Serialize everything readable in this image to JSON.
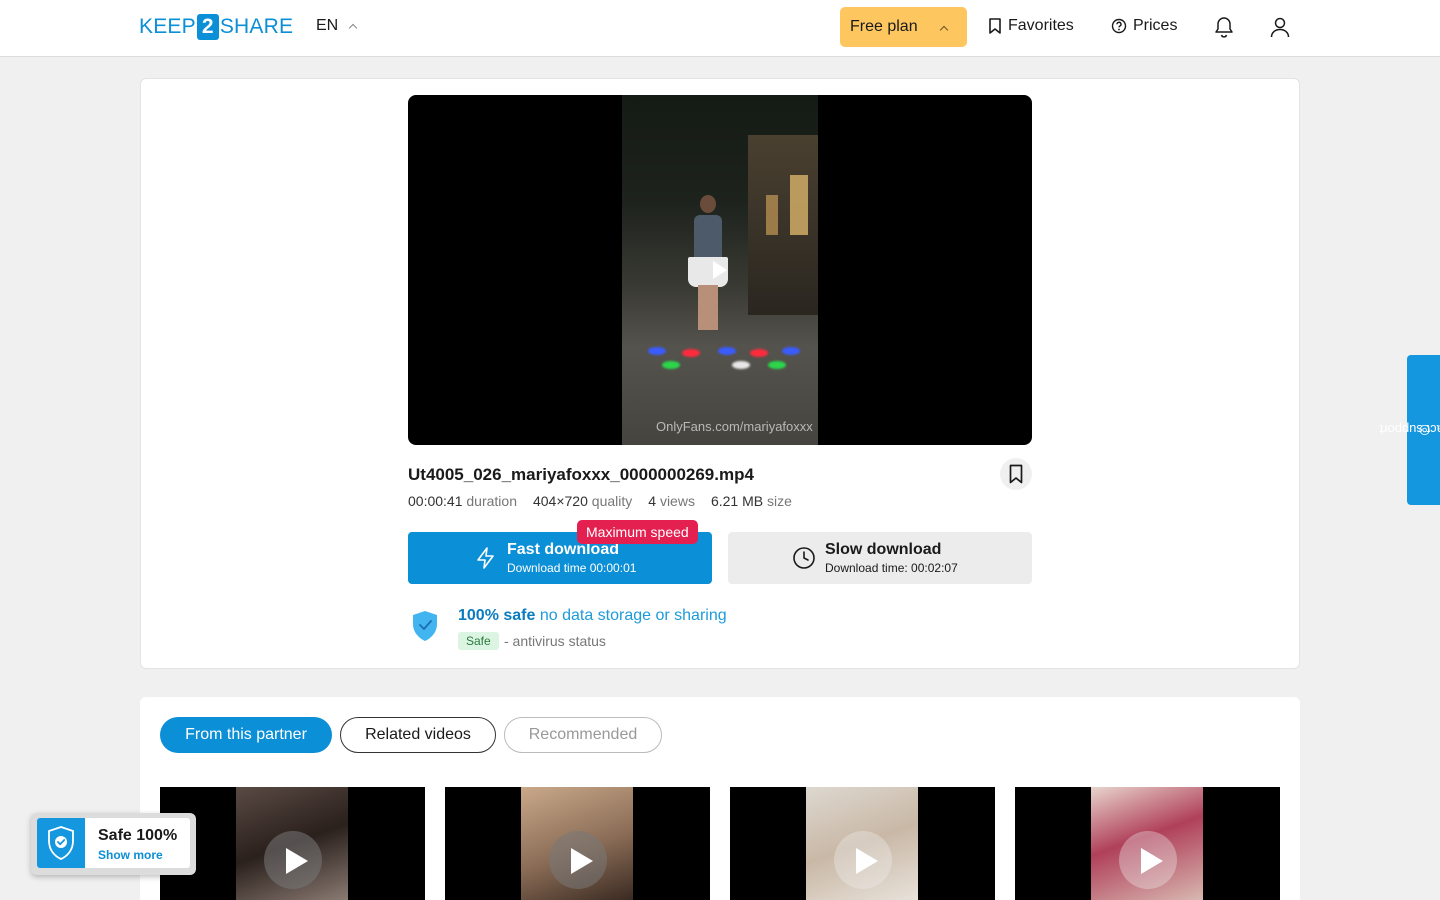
{
  "header": {
    "logo_left": "KEEP",
    "logo_mid": "2",
    "logo_right": "SHARE",
    "language": "EN",
    "plan_label": "Free plan",
    "favorites_label": "Favorites",
    "prices_label": "Prices",
    "icons": [
      "bookmark-icon",
      "help-circle-icon",
      "bell-icon",
      "user-icon"
    ]
  },
  "file": {
    "video_watermark": "OnlyFans.com/mariyafoxxx",
    "name": "Ut4005_026_mariyafoxxx_0000000269.mp4",
    "duration": "00:00:41",
    "duration_label": "duration",
    "quality": "404×720",
    "quality_label": "quality",
    "views": "4",
    "views_label": "views",
    "size": "6.21 MB",
    "size_label": "size"
  },
  "download": {
    "badge": "Maximum speed",
    "fast_title": "Fast download",
    "fast_sub": "Download time 00:00:01",
    "slow_title": "Slow download",
    "slow_sub": "Download time: 00:02:07"
  },
  "safety": {
    "title_bold": "100% safe",
    "title_rest": "no data storage or sharing",
    "badge": "Safe",
    "status": "- antivirus status"
  },
  "support": {
    "label": "contact support"
  },
  "tabs": [
    {
      "label": "From this partner",
      "state": "active"
    },
    {
      "label": "Related videos",
      "state": "default"
    },
    {
      "label": "Recommended",
      "state": "disabled"
    }
  ],
  "safe_widget": {
    "title": "Safe 100%",
    "link": "Show more"
  },
  "colors": {
    "brand": "#0b8fd6",
    "plan": "#fdc65f",
    "badge": "#e3204f"
  }
}
